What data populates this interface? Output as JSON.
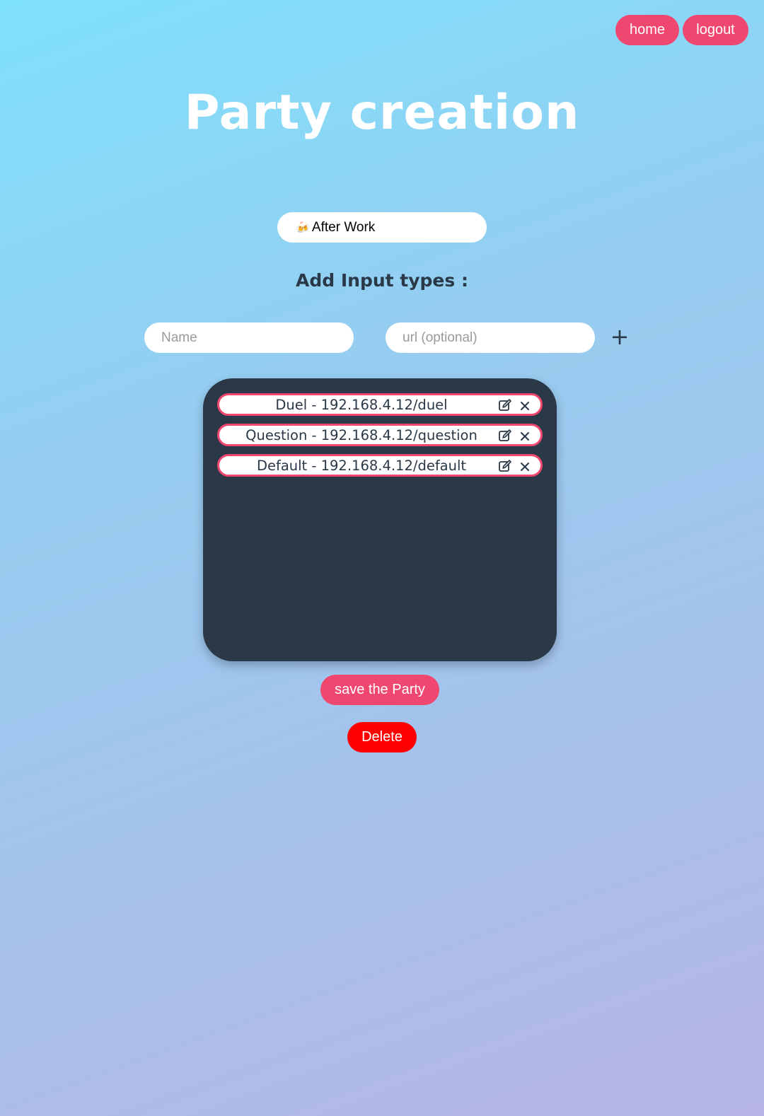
{
  "nav": {
    "home_label": "home",
    "logout_label": "logout"
  },
  "page": {
    "title": "Party creation"
  },
  "party": {
    "name_emoji": "🍻",
    "name": "After Work"
  },
  "input_types": {
    "heading": "Add Input types :",
    "name_placeholder": "Name",
    "url_placeholder": "url (optional)",
    "add_label": "+",
    "items": [
      {
        "label": "Duel - 192.168.4.12/duel"
      },
      {
        "label": "Question - 192.168.4.12/question"
      },
      {
        "label": "Default - 192.168.4.12/default"
      }
    ]
  },
  "actions": {
    "save_label": "save the Party",
    "delete_label": "Delete"
  },
  "colors": {
    "accent": "#ef476f",
    "danger": "#ff0000",
    "panel": "#2a3847",
    "text_dark": "#2a3847"
  },
  "icons": {
    "edit": "edit-icon",
    "remove": "close-icon"
  }
}
